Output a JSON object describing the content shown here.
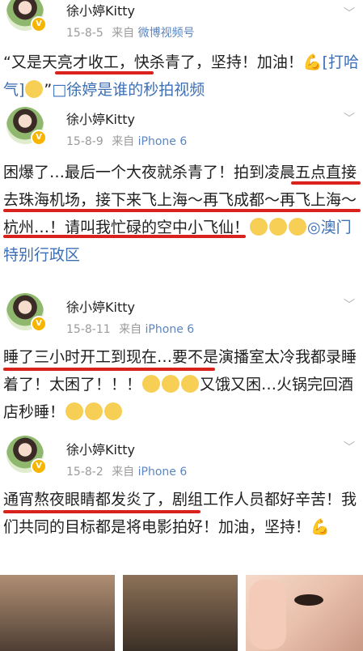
{
  "posts": [
    {
      "username": "徐小婷Kitty",
      "date": "15-8-5",
      "from": "来自",
      "source": "微博视频号",
      "text_parts": [
        "“又是天亮才收工，快杀青了，坚持！加油！",
        "[打哈气]",
        "”",
        "□徐婷是谁的秒拍视频"
      ]
    },
    {
      "username": "徐小婷Kitty",
      "date": "15-8-9",
      "from": "来自",
      "source": "iPhone 6",
      "text": "困爆了…最后一个大夜就杀青了！拍到凌晨五点直接去珠海机场，接下来飞上海～再飞成都～再飞上海～杭州…！请叫我忙碌的空中小飞仙！",
      "location": "◎澳门特别行政区"
    },
    {
      "username": "徐小婷Kitty",
      "date": "15-8-11",
      "from": "来自",
      "source": "iPhone 6",
      "text": "睡了三小时开工到现在…要不是演播室太冷我都录睡着了！太困了！！！",
      "text2": "又饿又困…火锅完回酒店秒睡！"
    },
    {
      "username": "徐小婷Kitty",
      "date": "15-8-2",
      "from": "来自",
      "source": "iPhone 6",
      "text": "通宵熬夜眼睛都发炎了，剧组工作人员都好辛苦！我们共同的目标都是将电影拍好！加油，坚持！"
    }
  ],
  "verified_badge": "V",
  "icons": [
    "chevron-down-icon",
    "flex-emoji-icon",
    "shy-emoji-icon",
    "location-icon",
    "video-icon"
  ],
  "colors": {
    "accent_link": "#3d6fb6",
    "underline": "#d9221c",
    "meta": "#9a9a9a"
  }
}
